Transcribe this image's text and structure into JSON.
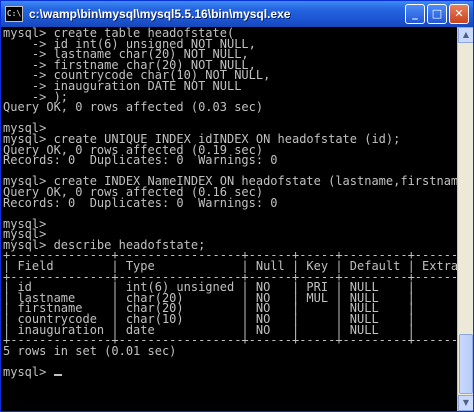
{
  "window": {
    "title": "c:\\wamp\\bin\\mysql\\mysql5.5.16\\bin\\mysql.exe",
    "icon_text": "C:\\",
    "buttons": {
      "minimize": "_",
      "maximize": "□",
      "close": "✕"
    }
  },
  "console": {
    "lines": [
      "mysql> create table headofstate(",
      "    -> id int(6) unsigned NOT NULL,",
      "    -> lastname char(20) NOT NULL,",
      "    -> firstname char(20) NOT NULL,",
      "    -> countrycode char(10) NOT NULL,",
      "    -> inauguration DATE NOT NULL",
      "    -> );",
      "Query OK, 0 rows affected (0.03 sec)",
      "",
      "mysql>",
      "mysql> create UNIQUE INDEX idINDEX ON headofstate (id);",
      "Query OK, 0 rows affected (0.19 sec)",
      "Records: 0  Duplicates: 0  Warnings: 0",
      "",
      "mysql> create INDEX NameINDEX ON headofstate (lastname,firstnam",
      "Query OK, 0 rows affected (0.16 sec)",
      "Records: 0  Duplicates: 0  Warnings: 0",
      "",
      "mysql>",
      "mysql>",
      "mysql> describe headofstate;",
      "+--------------+-----------------+------+-----+---------+-------",
      "| Field        | Type            | Null | Key | Default | Extra",
      "+--------------+-----------------+------+-----+---------+-------",
      "| id           | int(6) unsigned | NO   | PRI | NULL    |",
      "| lastname     | char(20)        | NO   | MUL | NULL    |",
      "| firstname    | char(20)        | NO   |     | NULL    |",
      "| countrycode  | char(10)        | NO   |     | NULL    |",
      "| inauguration | date            | NO   |     | NULL    |",
      "+--------------+-----------------+------+-----+---------+-------",
      "5 rows in set (0.01 sec)",
      "",
      "mysql> "
    ]
  },
  "scrollbar": {
    "up_arrow": "▲",
    "down_arrow": "▼"
  },
  "colors": {
    "console_bg": "#000000",
    "console_fg": "#c0c0c0",
    "titlebar": "#2666e0"
  }
}
